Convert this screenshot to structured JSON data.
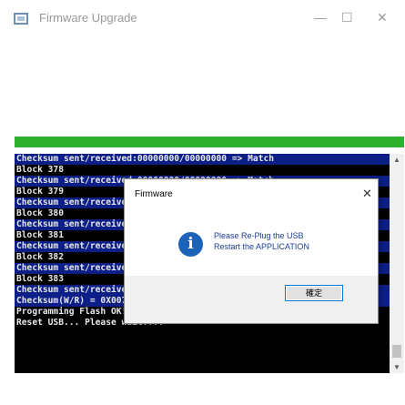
{
  "window": {
    "title": "Firmware Upgrade",
    "minimize_glyph": "—",
    "maximize_glyph": "☐",
    "close_glyph": "✕"
  },
  "progress": {
    "value": 1.0,
    "color": "#2fb02f"
  },
  "console": {
    "lines": [
      {
        "text": "Checksum sent/received:00000000/00000000 => Match",
        "highlight": true
      },
      {
        "text": "Block 378",
        "highlight": false
      },
      {
        "text": "Checksum sent/received:00000000/00000000 => Match",
        "highlight": true
      },
      {
        "text": "Block 379",
        "highlight": false
      },
      {
        "text": "Checksum sent/received:00000000/00000000 => Match",
        "highlight": true
      },
      {
        "text": "Block 380",
        "highlight": false
      },
      {
        "text": "Checksum sent/received:00000000/00000000 => Match",
        "highlight": true
      },
      {
        "text": "Block 381",
        "highlight": false
      },
      {
        "text": "Checksum sent/received:00000000/00000000 => Match",
        "highlight": true
      },
      {
        "text": "Block 382",
        "highlight": false
      },
      {
        "text": "Checksum sent/received:00000000/00000000 => Match",
        "highlight": true
      },
      {
        "text": "Block 383",
        "highlight": false
      },
      {
        "text": "Checksum sent/received:00000000/00000000 => Match",
        "highlight": true
      },
      {
        "text": "Checksum(W/R) = 0X0075C9BE | 0X0075C9BE",
        "highlight": true
      },
      {
        "text": "Programming Flash OK!!",
        "highlight": false
      },
      {
        "text": "Reset USB... Please wait....",
        "highlight": false
      }
    ]
  },
  "dialog": {
    "title": "Firmware",
    "close_glyph": "✕",
    "icon_glyph": "i",
    "message_line1": "Please Re-Plug the USB",
    "message_line2": "Restart the APPLICATION",
    "ok_label": "確定"
  },
  "scrollbar": {
    "up_glyph": "▲",
    "down_glyph": "▼"
  },
  "colors": {
    "console_bg": "#000000",
    "highlight_bg": "#0c1f86",
    "accent": "#0078d7",
    "info_blue": "#1b62b8"
  }
}
